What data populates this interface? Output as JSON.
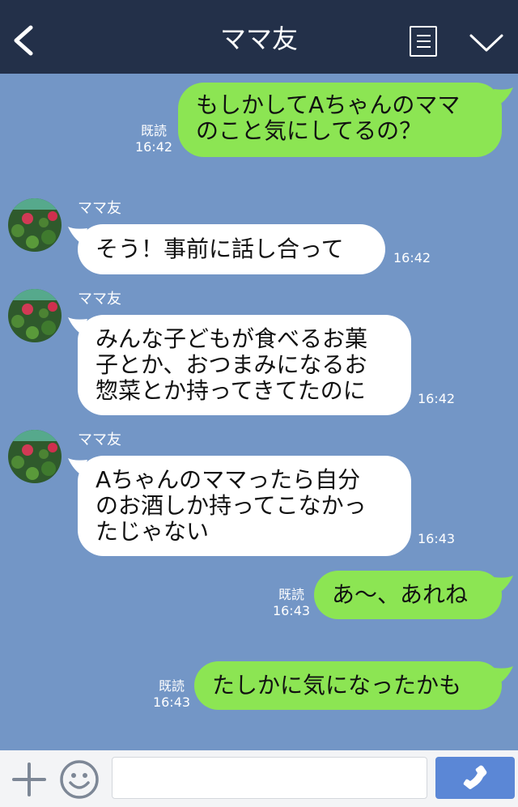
{
  "header": {
    "title": "ママ友",
    "back_icon": "chevron-left-icon",
    "menu_icon": "list-icon",
    "expand_icon": "chevron-down-icon",
    "background": "#233049"
  },
  "chat": {
    "background": "#7396c6",
    "sent_bubble_color": "#8ce553",
    "received_bubble_color": "#ffffff",
    "messages": [
      {
        "direction": "sent",
        "lines": [
          "もしかしてAちゃんのママ",
          "のこと気にしてるの？"
        ],
        "read_label": "既読",
        "time": "16:42"
      },
      {
        "direction": "received",
        "sender": "ママ友",
        "lines": [
          "そう！事前に話し合って"
        ],
        "time": "16:42"
      },
      {
        "direction": "received",
        "sender": "ママ友",
        "lines": [
          "みんな子どもが食べるお菓",
          "子とか、おつまみになるお",
          "惣菜とか持ってきてたのに"
        ],
        "time": "16:42"
      },
      {
        "direction": "received",
        "sender": "ママ友",
        "lines": [
          "Aちゃんのママったら自分",
          "のお酒しか持ってこなかっ",
          "たじゃない"
        ],
        "time": "16:43"
      },
      {
        "direction": "sent",
        "lines": [
          "あ〜、あれね"
        ],
        "read_label": "既読",
        "time": "16:43"
      },
      {
        "direction": "sent",
        "lines": [
          "たしかに気になったかも"
        ],
        "read_label": "既読",
        "time": "16:43"
      }
    ]
  },
  "input_bar": {
    "plus_icon": "plus-icon",
    "sticker_icon": "smiley-icon",
    "message_value": "",
    "call_icon": "phone-icon",
    "call_button_color": "#5b87d6"
  }
}
